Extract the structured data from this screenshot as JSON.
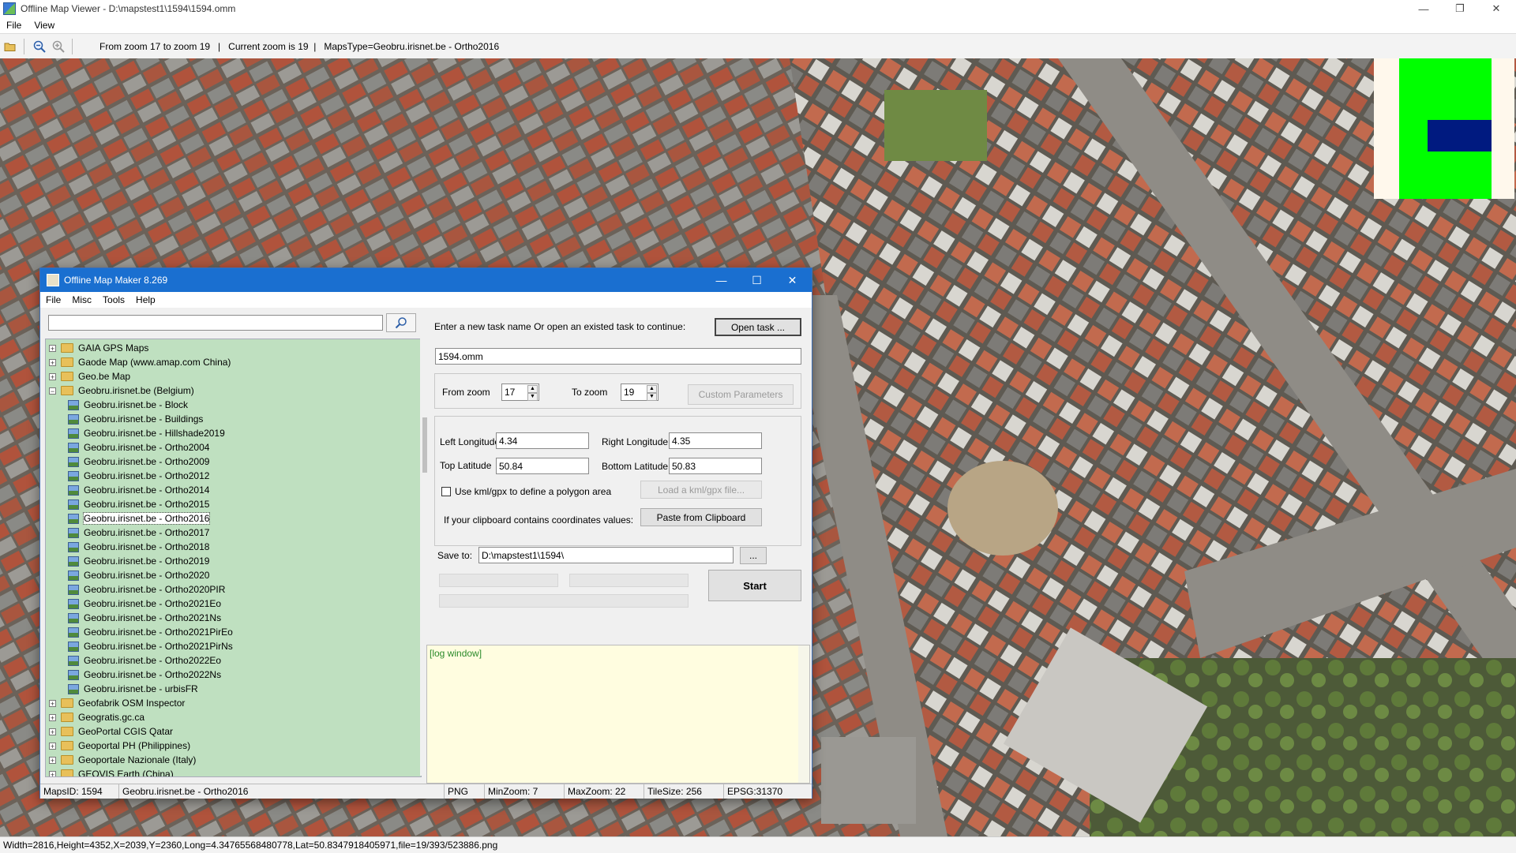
{
  "viewer": {
    "title": "Offline Map Viewer - D:\\mapstest1\\1594\\1594.omm",
    "menu": [
      "File",
      "View"
    ],
    "toolbar_status": "From zoom 17 to zoom 19   |   Current zoom is 19  |   MapsType=Geobru.irisnet.be - Ortho2016",
    "status_bar": "Width=2816,Height=4352,X=2039,Y=2360,Long=4.34765568480778,Lat=50.8347918405971,file=19/393/523886.png",
    "minimap_colors": {
      "background": "#fff8ec",
      "extent": "#00ff00",
      "viewport": "#001a80"
    }
  },
  "dialog": {
    "title": "Offline Map Maker 8.269",
    "menu": [
      "File",
      "Misc",
      "Tools",
      "Help"
    ],
    "search_value": "",
    "tree": [
      {
        "label": "GAIA GPS Maps",
        "type": "folder",
        "expanded": false
      },
      {
        "label": "Gaode Map (www.amap.com China)",
        "type": "folder",
        "expanded": false
      },
      {
        "label": "Geo.be Map",
        "type": "folder",
        "expanded": false
      },
      {
        "label": "Geobru.irisnet.be (Belgium)",
        "type": "folder",
        "expanded": true
      },
      {
        "label": "Geobru.irisnet.be - Block",
        "type": "map"
      },
      {
        "label": "Geobru.irisnet.be - Buildings",
        "type": "map"
      },
      {
        "label": "Geobru.irisnet.be - Hillshade2019",
        "type": "map"
      },
      {
        "label": "Geobru.irisnet.be - Ortho2004",
        "type": "map"
      },
      {
        "label": "Geobru.irisnet.be - Ortho2009",
        "type": "map"
      },
      {
        "label": "Geobru.irisnet.be - Ortho2012",
        "type": "map"
      },
      {
        "label": "Geobru.irisnet.be - Ortho2014",
        "type": "map"
      },
      {
        "label": "Geobru.irisnet.be - Ortho2015",
        "type": "map"
      },
      {
        "label": "Geobru.irisnet.be - Ortho2016",
        "type": "map",
        "selected": true
      },
      {
        "label": "Geobru.irisnet.be - Ortho2017",
        "type": "map"
      },
      {
        "label": "Geobru.irisnet.be - Ortho2018",
        "type": "map"
      },
      {
        "label": "Geobru.irisnet.be - Ortho2019",
        "type": "map"
      },
      {
        "label": "Geobru.irisnet.be - Ortho2020",
        "type": "map"
      },
      {
        "label": "Geobru.irisnet.be - Ortho2020PIR",
        "type": "map"
      },
      {
        "label": "Geobru.irisnet.be - Ortho2021Eo",
        "type": "map"
      },
      {
        "label": "Geobru.irisnet.be - Ortho2021Ns",
        "type": "map"
      },
      {
        "label": "Geobru.irisnet.be - Ortho2021PirEo",
        "type": "map"
      },
      {
        "label": "Geobru.irisnet.be - Ortho2021PirNs",
        "type": "map"
      },
      {
        "label": "Geobru.irisnet.be - Ortho2022Eo",
        "type": "map"
      },
      {
        "label": "Geobru.irisnet.be - Ortho2022Ns",
        "type": "map"
      },
      {
        "label": "Geobru.irisnet.be - urbisFR",
        "type": "map"
      },
      {
        "label": "Geofabrik OSM Inspector",
        "type": "folder",
        "expanded": false
      },
      {
        "label": "Geogratis.gc.ca",
        "type": "folder",
        "expanded": false
      },
      {
        "label": "GeoPortal CGIS Qatar",
        "type": "folder",
        "expanded": false
      },
      {
        "label": "Geoportal PH (Philippines)",
        "type": "folder",
        "expanded": false
      },
      {
        "label": "Geoportale Nazionale (Italy)",
        "type": "folder",
        "expanded": false
      },
      {
        "label": "GEOVIS Earth (China)",
        "type": "folder",
        "expanded": false
      }
    ],
    "task_prompt": "Enter a new task name Or open an existed task to continue:",
    "open_task_label": "Open task ...",
    "task_name": "1594.omm",
    "from_zoom_label": "From zoom",
    "from_zoom": "17",
    "to_zoom_label": "To zoom",
    "to_zoom": "19",
    "custom_params_label": "Custom Parameters",
    "left_lon_label": "Left Longitude",
    "left_lon": "4.34",
    "right_lon_label": "Right Longitude",
    "right_lon": "4.35",
    "top_lat_label": "Top Latitude",
    "top_lat": "50.84",
    "bottom_lat_label": "Bottom Latitude",
    "bottom_lat": "50.83",
    "kml_check_label": "Use kml/gpx to define a polygon area",
    "kml_checked": false,
    "load_kml_label": "Load a kml/gpx file...",
    "clipboard_label": "If your clipboard contains coordinates values:",
    "paste_label": "Paste from Clipboard",
    "save_to_label": "Save to:",
    "save_to": "D:\\mapstest1\\1594\\",
    "browse_label": "...",
    "start_label": "Start",
    "log_text": "[log window]",
    "status": {
      "maps_id": "MapsID: 1594",
      "map_name": "Geobru.irisnet.be - Ortho2016",
      "format": "PNG",
      "min_zoom": "MinZoom: 7",
      "max_zoom": "MaxZoom: 22",
      "tile_size": "TileSize: 256",
      "epsg": "EPSG:31370"
    }
  }
}
